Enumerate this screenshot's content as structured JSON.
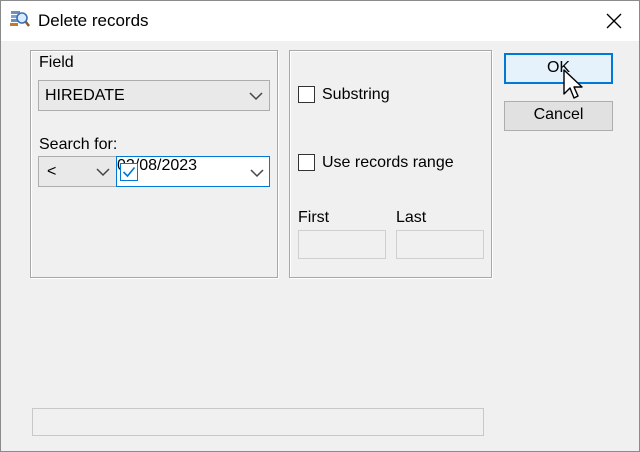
{
  "window": {
    "title": "Delete records",
    "app_icon": "database-search-icon",
    "close_icon": "close-icon"
  },
  "field_group": {
    "field_label": "Field",
    "field_value": "HIREDATE",
    "search_label": "Search for:",
    "operator_value": "<",
    "date_checked": true,
    "date_value": "02/08/2023"
  },
  "options_group": {
    "substring_label": "Substring",
    "substring_checked": false,
    "range_label": "Use records range",
    "range_checked": false,
    "first_label": "First",
    "last_label": "Last",
    "first_value": "",
    "last_value": ""
  },
  "buttons": {
    "ok_label": "OK",
    "cancel_label": "Cancel"
  },
  "status": {
    "text": ""
  },
  "colors": {
    "accent": "#0078d7",
    "dialog_bg": "#f0f0f0",
    "button_bg": "#e1e1e1"
  }
}
